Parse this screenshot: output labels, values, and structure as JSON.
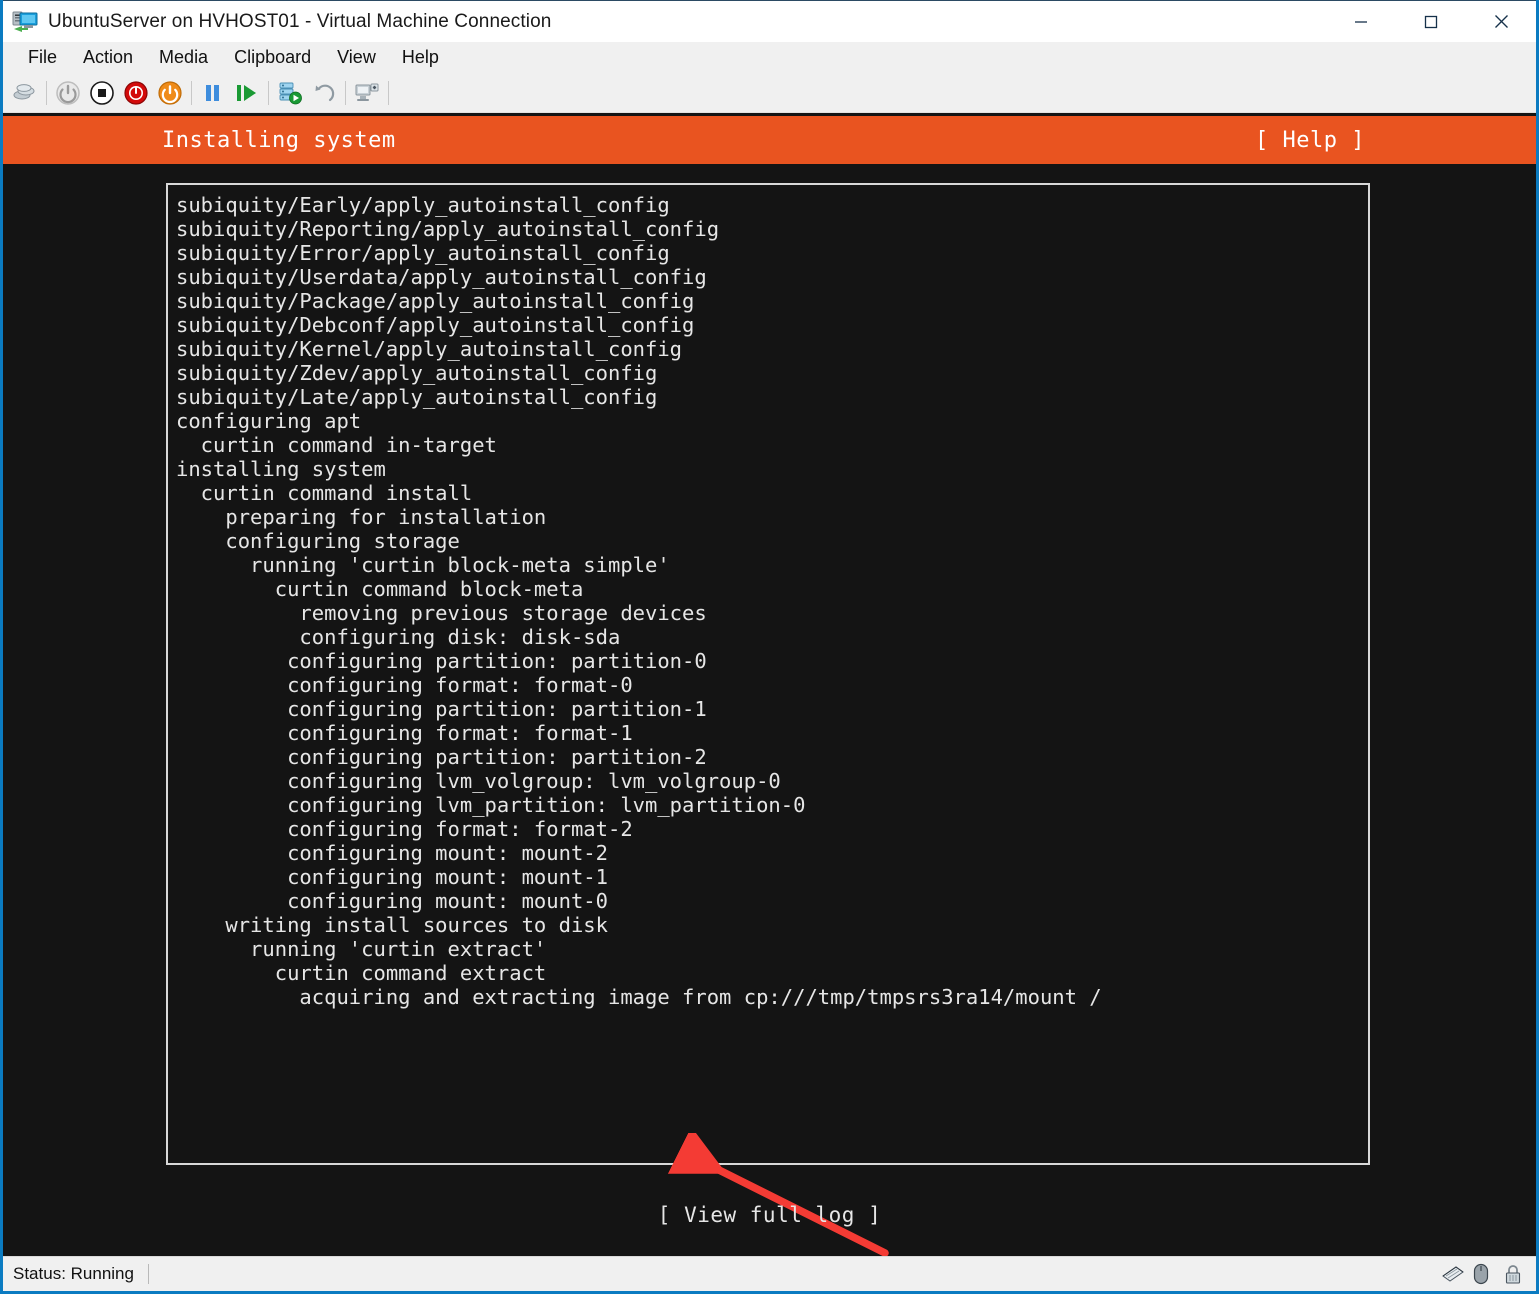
{
  "window": {
    "title": "UbuntuServer on HVHOST01 - Virtual Machine Connection",
    "icon": "virtual-machine-icon",
    "controls": {
      "minimize": "minimize-icon",
      "maximize": "maximize-icon",
      "close": "close-icon"
    }
  },
  "menubar": {
    "items": [
      {
        "label": "File"
      },
      {
        "label": "Action"
      },
      {
        "label": "Media"
      },
      {
        "label": "Clipboard"
      },
      {
        "label": "View"
      },
      {
        "label": "Help"
      }
    ]
  },
  "toolbar": {
    "buttons": [
      {
        "name": "ctrl-alt-delete-icon",
        "title": "Ctrl+Alt+Delete"
      },
      {
        "name": "start-icon",
        "title": "Start"
      },
      {
        "name": "shutdown-icon",
        "title": "Shut Down"
      },
      {
        "name": "turn-off-icon",
        "title": "Turn Off"
      },
      {
        "name": "reset-icon",
        "title": "Reset"
      },
      {
        "name": "pause-icon",
        "title": "Pause"
      },
      {
        "name": "resume-icon",
        "title": "Resume"
      },
      {
        "name": "checkpoint-icon",
        "title": "Checkpoint"
      },
      {
        "name": "revert-icon",
        "title": "Revert"
      },
      {
        "name": "enhanced-session-icon",
        "title": "Enhanced Session"
      }
    ]
  },
  "vm": {
    "header": {
      "title": "Installing system",
      "help": "[ Help ]",
      "background": "#e95420",
      "foreground": "#ffffff"
    },
    "log": {
      "border_color": "#d8d8d8",
      "background": "#141414",
      "foreground": "#e6e6e6",
      "lines": [
        "subiquity/Early/apply_autoinstall_config",
        "subiquity/Reporting/apply_autoinstall_config",
        "subiquity/Error/apply_autoinstall_config",
        "subiquity/Userdata/apply_autoinstall_config",
        "subiquity/Package/apply_autoinstall_config",
        "subiquity/Debconf/apply_autoinstall_config",
        "subiquity/Kernel/apply_autoinstall_config",
        "subiquity/Zdev/apply_autoinstall_config",
        "subiquity/Late/apply_autoinstall_config",
        "configuring apt",
        "  curtin command in-target",
        "installing system",
        "  curtin command install",
        "    preparing for installation",
        "    configuring storage",
        "      running 'curtin block-meta simple'",
        "        curtin command block-meta",
        "          removing previous storage devices",
        "          configuring disk: disk-sda",
        "         configuring partition: partition-0",
        "         configuring format: format-0",
        "         configuring partition: partition-1",
        "         configuring format: format-1",
        "         configuring partition: partition-2",
        "         configuring lvm_volgroup: lvm_volgroup-0",
        "         configuring lvm_partition: lvm_partition-0",
        "         configuring format: format-2",
        "         configuring mount: mount-2",
        "         configuring mount: mount-1",
        "         configuring mount: mount-0",
        "    writing install sources to disk",
        "      running 'curtin extract'",
        "        curtin command extract",
        "          acquiring and extracting image from cp:///tmp/tmpsrs3ra14/mount /"
      ]
    },
    "footer": {
      "view_full_log": "[ View full log ]"
    },
    "annotation": {
      "type": "arrow",
      "color": "#f43b34",
      "points_to": "acquiring and extracting image from cp:///tmp/tmpsrs3ra14/mount /"
    }
  },
  "statusbar": {
    "status": "Status: Running",
    "icons": [
      {
        "name": "keyboard-icon"
      },
      {
        "name": "mouse-icon"
      },
      {
        "name": "lock-icon"
      }
    ]
  }
}
